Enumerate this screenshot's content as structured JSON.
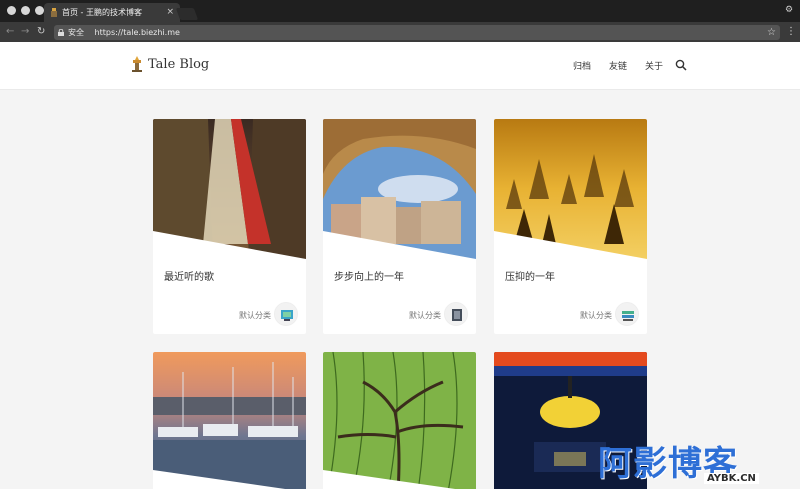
{
  "browser": {
    "tab_title": "首页 - 王鹏的技术博客",
    "tab_close": "×",
    "secure_label": "安全",
    "url": "https://tale.biezhi.me"
  },
  "site": {
    "logo_text": "Tale Blog",
    "nav": [
      "归档",
      "友链",
      "关于"
    ]
  },
  "posts": [
    {
      "title": "最近听的歌",
      "category": "默认分类",
      "image": "city-street-night",
      "cat_icon": "screen-icon"
    },
    {
      "title": "步步向上的一年",
      "category": "默认分类",
      "image": "building-sky",
      "cat_icon": "book-icon"
    },
    {
      "title": "压抑的一年",
      "category": "默认分类",
      "image": "foggy-forest",
      "cat_icon": "layers-icon"
    },
    {
      "title": "",
      "category": "",
      "image": "harbor-sunset",
      "cat_icon": ""
    },
    {
      "title": "",
      "category": "",
      "image": "willow-tree",
      "cat_icon": ""
    },
    {
      "title": "",
      "category": "",
      "image": "subway-station",
      "cat_icon": ""
    }
  ],
  "watermark": {
    "text": "阿影博客",
    "sub": "AYBK.CN"
  },
  "colors": {
    "accent": "#2e6fd6",
    "page_bg": "#f4f4f4"
  }
}
